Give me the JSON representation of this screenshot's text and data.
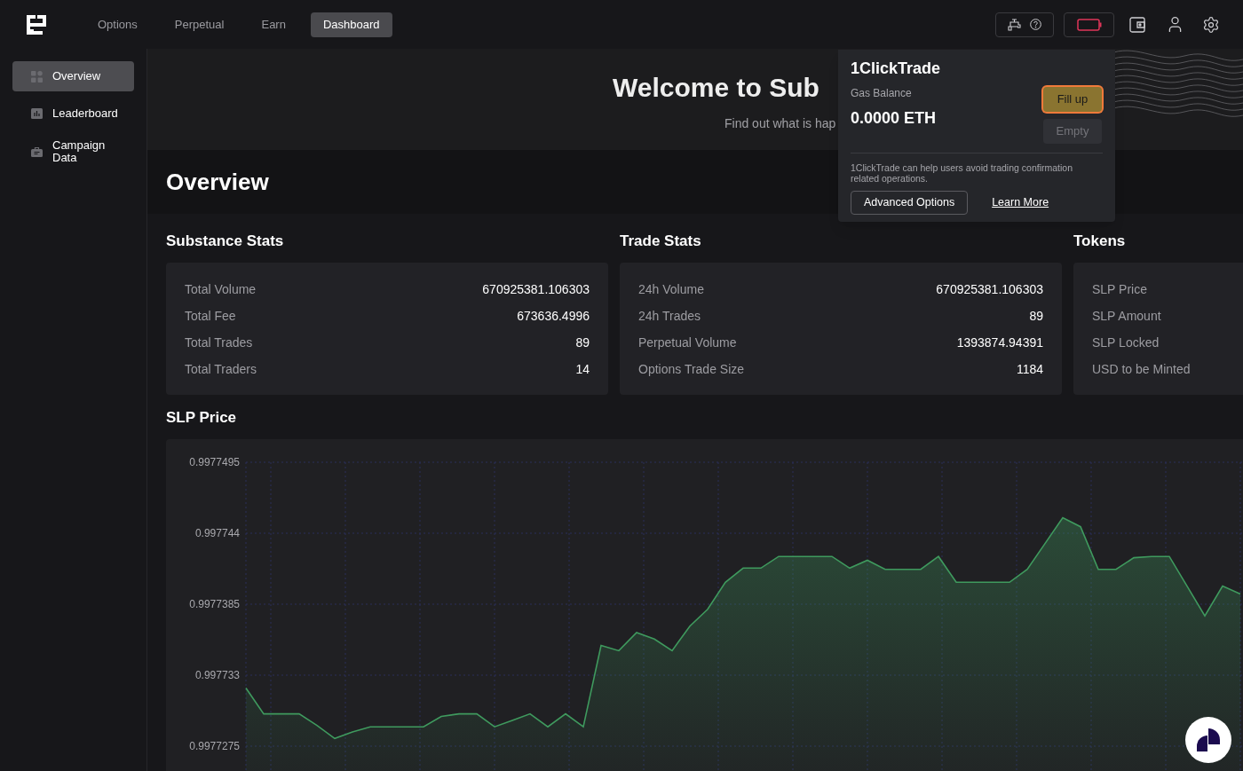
{
  "nav": [
    {
      "label": "Options",
      "selected": false
    },
    {
      "label": "Perpetual",
      "selected": false
    },
    {
      "label": "Earn",
      "selected": false
    },
    {
      "label": "Dashboard",
      "selected": true
    }
  ],
  "sidebar": {
    "items": [
      {
        "label": "Overview",
        "selected": true
      },
      {
        "label": "Leaderboard",
        "selected": false
      },
      {
        "label": "Campaign Data",
        "selected": false
      }
    ]
  },
  "banner": {
    "title": "Welcome to Sub",
    "subtitle": "Find out what is hap"
  },
  "page_title": "Overview",
  "stats": [
    {
      "title": "Substance Stats",
      "rows": [
        {
          "label": "Total Volume",
          "value": "670925381.106303"
        },
        {
          "label": "Total Fee",
          "value": "673636.4996"
        },
        {
          "label": "Total Trades",
          "value": "89"
        },
        {
          "label": "Total Traders",
          "value": "14"
        }
      ]
    },
    {
      "title": "Trade Stats",
      "rows": [
        {
          "label": "24h Volume",
          "value": "670925381.106303"
        },
        {
          "label": "24h Trades",
          "value": "89"
        },
        {
          "label": "Perpetual Volume",
          "value": "1393874.94391"
        },
        {
          "label": "Options Trade Size",
          "value": "1184"
        }
      ]
    },
    {
      "title": "Tokens",
      "rows": [
        {
          "label": "SLP Price"
        },
        {
          "label": "SLP Amount"
        },
        {
          "label": "SLP Locked"
        },
        {
          "label": "USD to be Minted"
        }
      ]
    }
  ],
  "price": {
    "title": "SLP Price",
    "chart_data": {
      "type": "area",
      "ylim": [
        0.9977275,
        0.9977495
      ],
      "yticks": [
        {
          "value": 0.9977495,
          "label": "0.9977495"
        },
        {
          "value": 0.997744,
          "label": "0.997744"
        },
        {
          "value": 0.9977385,
          "label": "0.9977385"
        },
        {
          "value": 0.997733,
          "label": "0.997733"
        },
        {
          "value": 0.9977275,
          "label": "0.9977275"
        }
      ],
      "grid": true,
      "series": [
        {
          "color": "#3f9a5e",
          "values": [
            0.997732,
            0.99773,
            0.99773,
            0.99773,
            0.9977291,
            0.9977281,
            0.9977286,
            0.997729,
            0.997729,
            0.997729,
            0.997729,
            0.9977298,
            0.99773,
            0.99773,
            0.997729,
            0.9977295,
            0.99773,
            0.997729,
            0.99773,
            0.997729,
            0.9977353,
            0.9977349,
            0.9977363,
            0.9977358,
            0.9977349,
            0.9977368,
            0.9977381,
            0.9977402,
            0.9977413,
            0.9977413,
            0.9977422,
            0.9977422,
            0.9977422,
            0.9977422,
            0.9977413,
            0.9977419,
            0.9977412,
            0.9977412,
            0.9977412,
            0.9977422,
            0.9977402,
            0.9977402,
            0.9977402,
            0.9977402,
            0.9977412,
            0.9977432,
            0.9977452,
            0.9977445,
            0.9977412,
            0.9977412,
            0.9977421,
            0.9977422,
            0.9977422,
            0.9977399,
            0.9977376,
            0.9977399,
            0.9977393
          ]
        }
      ]
    }
  },
  "popover": {
    "title": "1ClickTrade",
    "balance_label": "Gas Balance",
    "balance": "0.0000 ETH",
    "actions": [
      {
        "label": "Fill up",
        "kind": "primary",
        "focused": true,
        "disabled": false
      },
      {
        "label": "Empty",
        "kind": "secondary",
        "focused": false,
        "disabled": true
      }
    ],
    "description": "1ClickTrade can help users avoid trading confirmation related operations.",
    "advanced_button": "Advanced Options",
    "learn_more": "Learn More"
  }
}
